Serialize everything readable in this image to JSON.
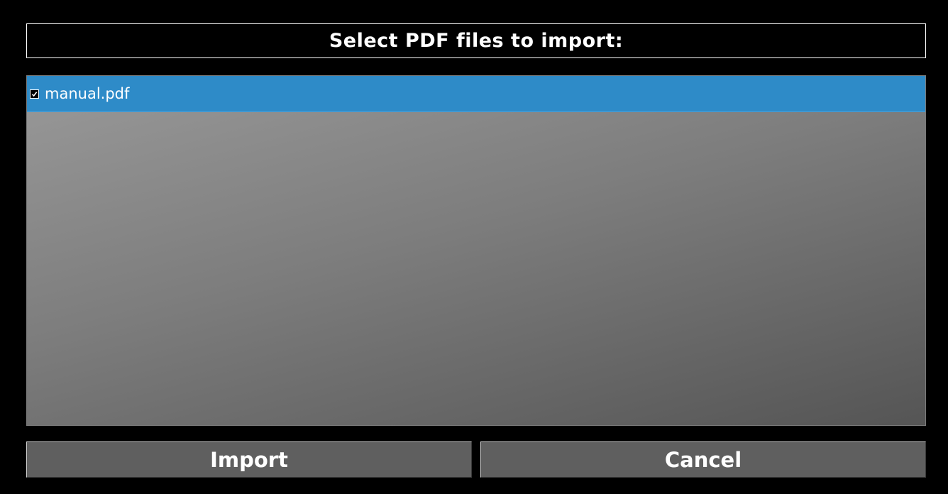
{
  "dialog": {
    "title": "Select PDF files to import:"
  },
  "files": [
    {
      "name": "manual.pdf",
      "checked": true,
      "selected": true,
      "checkbox_icon": "checkbox-checked-icon"
    }
  ],
  "buttons": {
    "import_label": "Import",
    "cancel_label": "Cancel"
  },
  "colors": {
    "background": "#000000",
    "selection": "#2e8bc8",
    "button": "#5f5f5f",
    "text": "#ffffff"
  }
}
